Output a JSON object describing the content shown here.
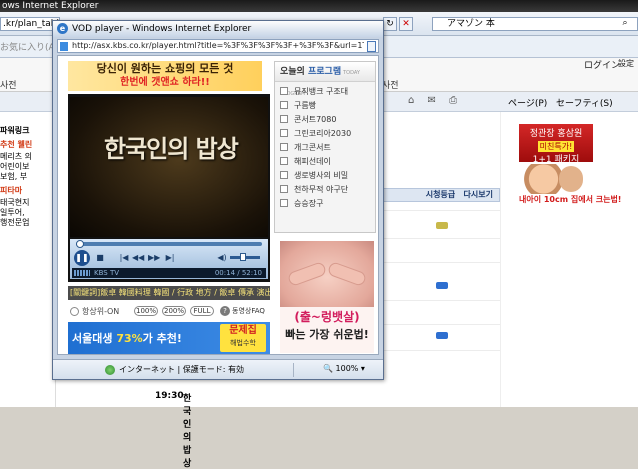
{
  "background_window": {
    "title_fragment": "ows Internet Explorer",
    "url_fragment": ".kr/plan_table",
    "search_text": "アマゾン 本",
    "favorites_label": "お気に入り(A)",
    "site": {
      "left_heading": "사전",
      "right_heading": "사전",
      "login_label": "ログイン",
      "settings_label": "設定"
    },
    "command_bar": {
      "page_label": "ページ(P)",
      "safety_label": "セーフティ(S)"
    },
    "left_column": {
      "lines": [
        "파워링크",
        "추천 웰린",
        "메리츠 의",
        "어린이보",
        "보험, 부",
        "피타마",
        "태국현지",
        "일투어,",
        "행전문업"
      ]
    },
    "schedule": {
      "header_grade": "시청등급",
      "header_replay": "다시보기",
      "bottom_time": "19:30",
      "bottom_title": "한국인의 밥상"
    },
    "ads": {
      "banner_title": "정관장 홍삼원",
      "banner_tag": "미친특가!",
      "banner_sub": "1+1 패키지",
      "kids_text": "내아이 10cm 집에서 크는법!"
    }
  },
  "popup": {
    "title": "VOD player - Windows Internet Explorer",
    "url": "http://asx.kbs.co.kr/player.html?title=%3F%3F%3F%3F+%3F%3F&url=1TV%242",
    "banner": {
      "line1": "당신이 원하는 쇼핑의 모든 것",
      "line2": "한번에 갯앤쇼 하라!!"
    },
    "video": {
      "calligraphy": "한국인의 밥상",
      "channel": "KBS TV",
      "time": "00:14 / 52:10"
    },
    "tag_line": "[關鍵詞]飯卓 韓國料理 韓國 / 行政 地方 / 飯卓 傳承 演出",
    "options": {
      "always_on": "항상위-ON",
      "sizes": [
        "100%",
        "200%",
        "FULL"
      ],
      "faq": "동영상FAQ"
    },
    "study_ad": {
      "text_pre": "서울대생 ",
      "text_num": "73%",
      "text_post": "가 추천!",
      "box_title": "문제집",
      "box_sub": "해법수학"
    },
    "program_panel": {
      "title_pre": "오늘의",
      "title_bold": "프로그램",
      "title_en": "TODAY PROGRAM",
      "items": [
        "뮤직뱅크 구조대",
        "구름빵",
        "콘서트7080",
        "그린코리아2030",
        "개그콘서트",
        "해피선데이",
        "생로병사의 비밀",
        "천하무적 야구단",
        "승승장구"
      ]
    },
    "belly_ad": {
      "line1": "(출~렁뱃살)",
      "line2": "빠는 가장 쉬운법!"
    },
    "statusbar": {
      "zone": "インターネット | 保護モード: 有効",
      "zoom": "100%"
    }
  },
  "colors": {
    "ie_blue": "#2f76c7",
    "accent_red": "#e02424",
    "program_blue": "#2b5ea8"
  }
}
